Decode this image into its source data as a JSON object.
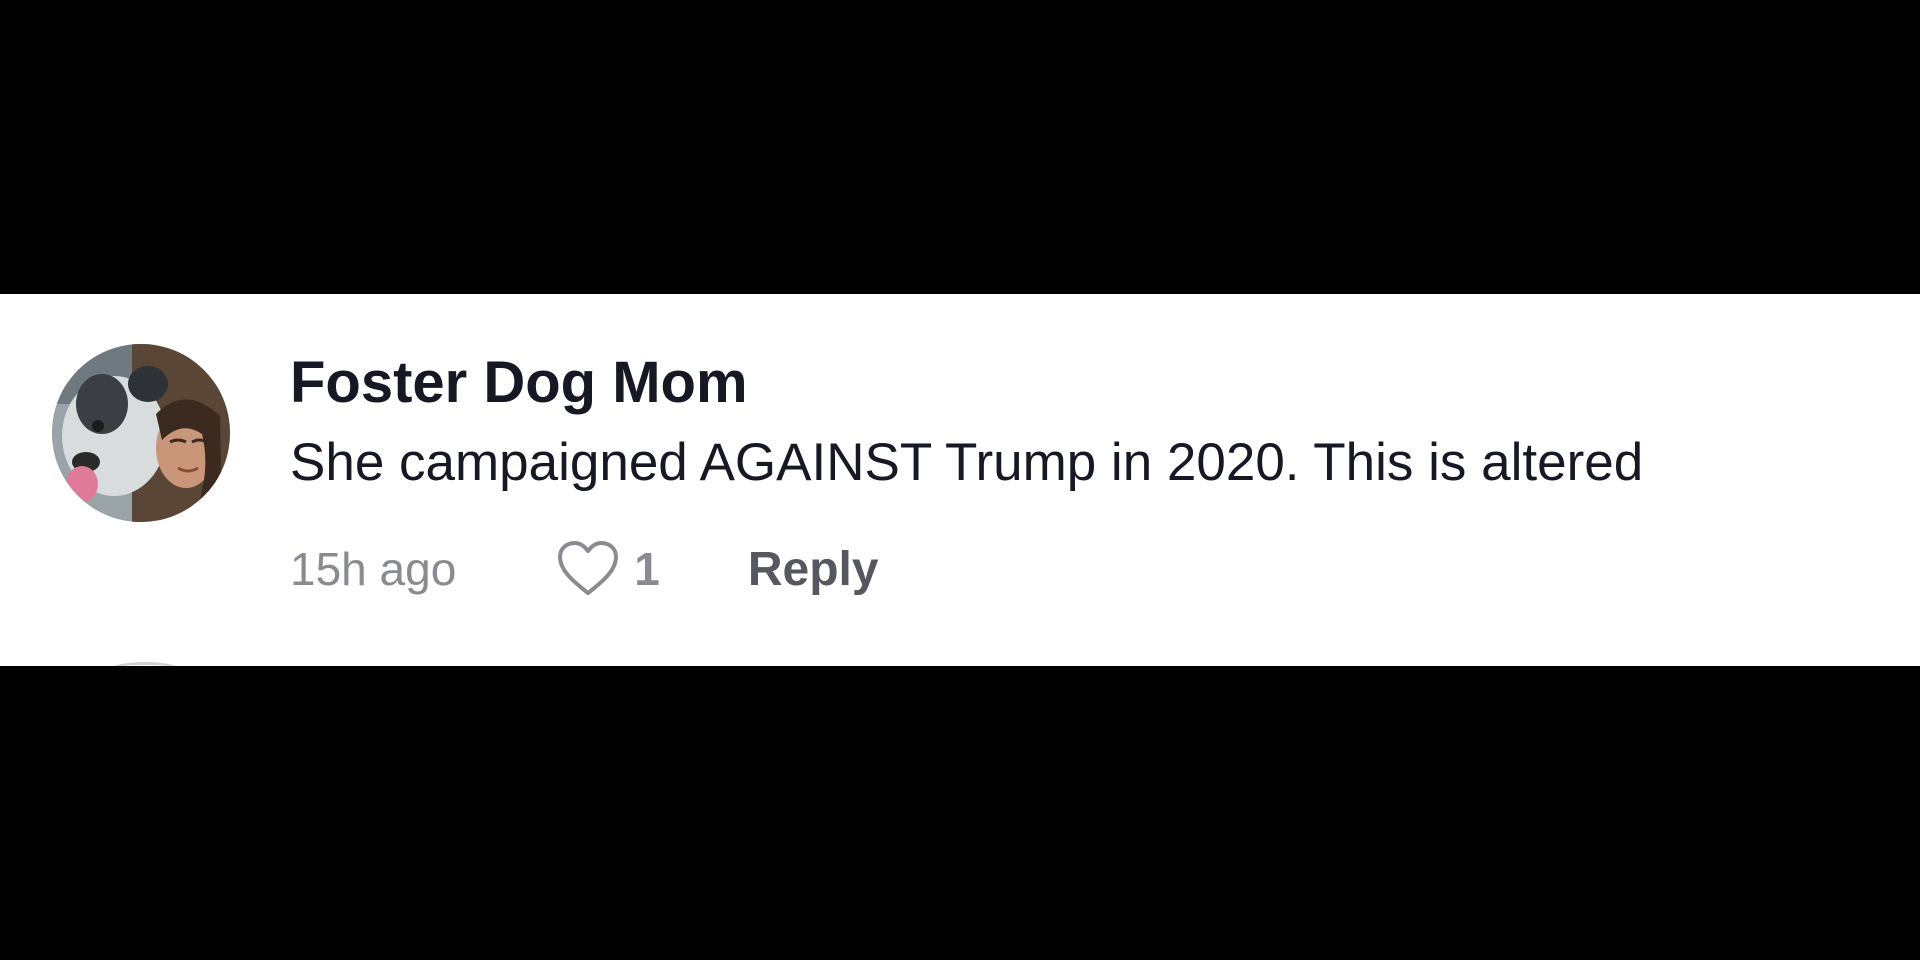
{
  "comment": {
    "author": "Foster Dog Mom",
    "text": "She campaigned AGAINST Trump in 2020. This is altered",
    "timestamp": "15h ago",
    "like_count": "1",
    "reply_label": "Reply",
    "avatar_icon": "user-avatar-photo"
  },
  "colors": {
    "letterbox": "#000000",
    "panel_bg": "#ffffff",
    "primary_text": "#161823",
    "secondary_text": "#8a8b91",
    "reply_text": "#57585f"
  }
}
